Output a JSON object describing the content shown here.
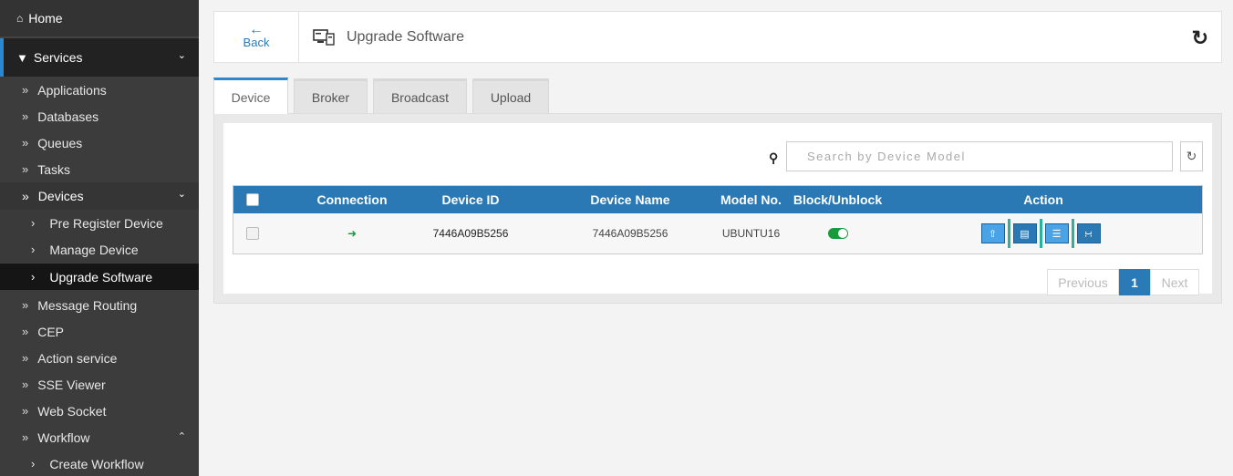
{
  "sidebar": {
    "home": "Home",
    "services": "Services",
    "items": [
      "Applications",
      "Databases",
      "Queues",
      "Tasks"
    ],
    "devices": "Devices",
    "device_subitems": [
      "Pre Register Device",
      "Manage Device",
      "Upgrade Software"
    ],
    "items_after": [
      "Message Routing",
      "CEP",
      "Action service",
      "SSE Viewer",
      "Web Socket",
      "Workflow"
    ],
    "workflow_sub": "Create Workflow"
  },
  "header": {
    "back_label": "Back",
    "title": "Upgrade Software"
  },
  "tabs": [
    "Device",
    "Broker",
    "Broadcast",
    "Upload"
  ],
  "search": {
    "placeholder": "Search by Device Model"
  },
  "table": {
    "columns": [
      "Connection",
      "Device ID",
      "Device Name",
      "Model No.",
      "Block/Unblock",
      "Action"
    ],
    "rows": [
      {
        "device_id": "7446A09B5256",
        "device_name": "7446A09B5256",
        "model": "UBUNTU16",
        "connected": true,
        "blocked_toggle": "on"
      }
    ]
  },
  "pagination": {
    "previous": "Previous",
    "current": "1",
    "next": "Next"
  },
  "colors": {
    "accent": "#2a79b4",
    "toggle_on": "#1a9a3c",
    "sidebar_bg": "#3c3c3c"
  }
}
